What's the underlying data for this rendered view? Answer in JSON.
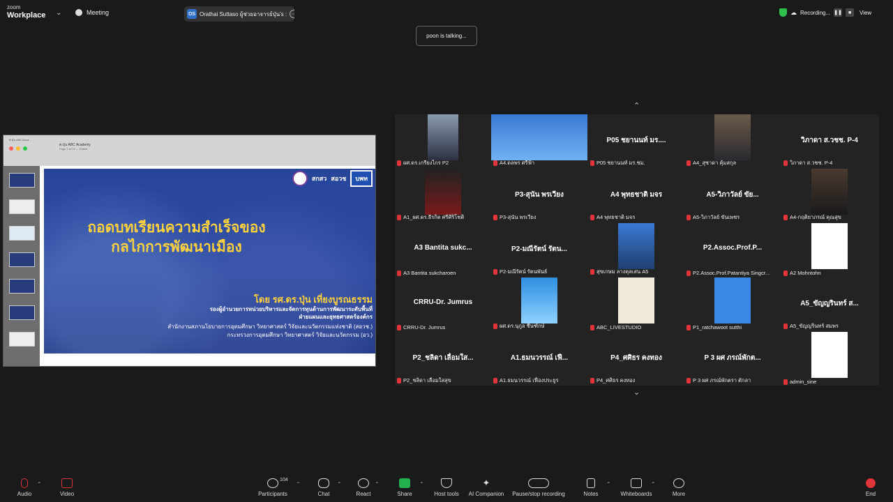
{
  "topbar": {
    "brand_small": "zoom",
    "brand_big": "Workplace",
    "meeting_label": "Meeting",
    "speaker_initials": "OS",
    "speaker_text": "Orathai Suttaso  ผู้ช่วยอาจารย์ปุ่น's :",
    "recording_label": "Recording...",
    "view_label": "View"
  },
  "talking": "poon is talking...",
  "shared_screen": {
    "tab_text": "ศ.ปุ่น ABC Acca...",
    "window_title": "ศ.ปุ่น ABC Academy",
    "window_sub": "Page 1 of 16 — Edited",
    "logo_1": "สกสว",
    "logo_2": "สอวช",
    "logo_3": "บพท",
    "title_line1": "ถอดบทเรียนความสำเร็จของ",
    "title_line2": "กลไกการพัฒนาเมือง",
    "by_line": "โดย รศ.ดร.ปุ่น เที่ยงบูรณธรรม",
    "role_line1": "รองผู้อำนวยการหน่วยบริหารและจัดการทุนด้านการพัฒนาระดับพื้นที่",
    "role_line2": "ฝ่ายแผนและยุทธศาสตร์องค์กร",
    "org_line1": "สำนักงานสภานโยบายการอุดมศึกษา วิทยาศาสตร์ วิจัยและนวัตกรรมแห่งชาติ (สอวช.)",
    "org_line2": "กระทรวงการอุดมศึกษา วิทยาศาสตร์ วิจัยและนวัตกรรม (อว.)"
  },
  "participants": [
    {
      "label": "ผศ.ดร.เกรียงไกร P2",
      "big": "",
      "video": "man"
    },
    {
      "label": "A4.ดลพร ศรีฟ้า",
      "big": "",
      "video": "slide"
    },
    {
      "label": "P05 ชยานนท์ มร.ชม.",
      "big": "P05 ชยานนท์ มร....",
      "video": ""
    },
    {
      "label": "A4_สุชาดา คุ้มสกุล",
      "big": "",
      "video": "woman"
    },
    {
      "label": "วิภาดา ส.วชช. P-4",
      "big": "วิภาดา ส.วชช. P-4",
      "video": ""
    },
    {
      "label": "A1_ผศ.ดร.ธีรกิต ศรีศิริโชติ",
      "big": "",
      "video": "man2"
    },
    {
      "label": "P3-สุนัน พรเวียง",
      "big": "P3-สุนัน พรเวียง",
      "video": ""
    },
    {
      "label": "A4 พุทธชาติ มจร",
      "big": "A4 พุทธชาติ มจร",
      "video": ""
    },
    {
      "label": "A5-วิภาวัลย์ ขันเพชร",
      "big": "A5-วิภาวัลย์ ขัย...",
      "video": ""
    },
    {
      "label": "A4-กฤติยาภรณ์ คุณสุข",
      "big": "",
      "video": "woman2"
    },
    {
      "label": "A3 Bantita sukcharoen",
      "big": "A3 Bantita sukc...",
      "video": ""
    },
    {
      "label": "P2-มณีรัตน์ รัตนพันธ์",
      "big": "P2-มณีรัตน์ รัตน...",
      "video": ""
    },
    {
      "label": "สุขเกษม ลางคุลเสน A5",
      "big": "",
      "video": "man3"
    },
    {
      "label": "P2.Assoc.Prof.Patantiya Singcr...",
      "big": "P2.Assoc.Prof.P...",
      "video": ""
    },
    {
      "label": "A2 Mohntohn",
      "big": "",
      "video": "logo"
    },
    {
      "label": "CRRU-Dr. Jumrus",
      "big": "CRRU-Dr. Jumrus",
      "video": ""
    },
    {
      "label": "ผศ.ดร.นุกูล ชื่นฑักษ์",
      "big": "",
      "video": "sky"
    },
    {
      "label": "ABC_LIVESTUDIO",
      "big": "",
      "video": "badge"
    },
    {
      "label": "P1_ratchawoot sutthi",
      "big": "",
      "video": "avatar"
    },
    {
      "label": "A5_ขัญญรินทร์ สมพร",
      "big": "A5_ขัญญรินทร์ ส...",
      "video": ""
    },
    {
      "label": "P2_ชลิดา เลื่อมใสสุข",
      "big": "P2_ชลิดา เลื่อมใส...",
      "video": ""
    },
    {
      "label": "A1.ธมนวรรณ์ เฟื่องประยูร",
      "big": "A1.ธมนวรรณ์ เฟื...",
      "video": ""
    },
    {
      "label": "P4_ศศิธร คงทอง",
      "big": "P4_ศศิธร คงทอง",
      "video": ""
    },
    {
      "label": "P 3 ผศ ภรณ์พักตรา ตักลา",
      "big": "P 3 ผศ ภรณ์พักต...",
      "video": ""
    },
    {
      "label": "admin_sine",
      "big": "",
      "video": "cartoon"
    }
  ],
  "toolbar": {
    "audio": "Audio",
    "video": "Video",
    "participants": "Participants",
    "participants_count": "104",
    "chat": "Chat",
    "react": "React",
    "share": "Share",
    "host_tools": "Host tools",
    "ai_companion": "AI Companion",
    "pause_recording": "Pause/stop recording",
    "notes": "Notes",
    "whiteboards": "Whiteboards",
    "more": "More",
    "end": "End"
  },
  "colors": {
    "share_green": "#22b14c",
    "end_red": "#e0343a",
    "mic_red": "#e0343a"
  }
}
